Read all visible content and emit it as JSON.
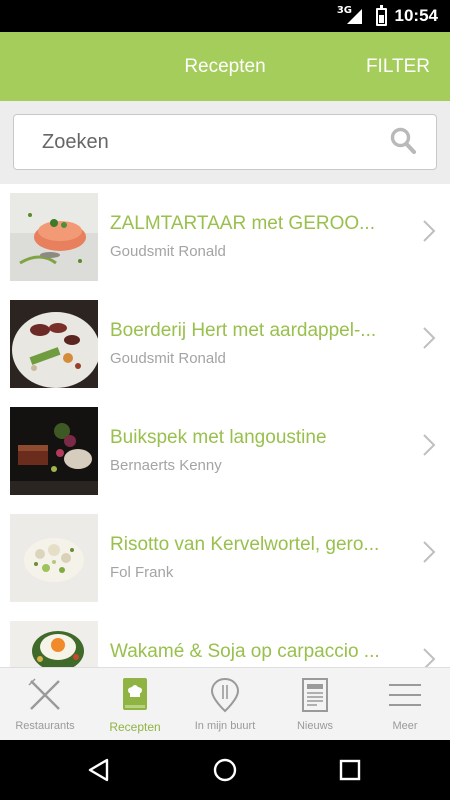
{
  "status_bar": {
    "network": "3G",
    "time": "10:54"
  },
  "header": {
    "title": "Recepten",
    "filter_label": "FILTER"
  },
  "search": {
    "placeholder": "Zoeken",
    "value": ""
  },
  "recipes": [
    {
      "name": "ZALMTARTAAR met GEROO...",
      "author": "Goudsmit Ronald"
    },
    {
      "name": "Boerderij Hert met aardappel-...",
      "author": "Goudsmit Ronald"
    },
    {
      "name": "Buikspek met langoustine",
      "author": "Bernaerts Kenny"
    },
    {
      "name": "Risotto van Kervelwortel, gero...",
      "author": "Fol Frank"
    },
    {
      "name": "Wakamé & Soja op carpaccio ...",
      "author": ""
    }
  ],
  "nav": {
    "items": [
      {
        "label": "Restaurants",
        "icon": "cutlery-icon",
        "active": false
      },
      {
        "label": "Recepten",
        "icon": "chef-hat-book-icon",
        "active": true
      },
      {
        "label": "In mijn buurt",
        "icon": "map-pin-icon",
        "active": false
      },
      {
        "label": "Nieuws",
        "icon": "newspaper-icon",
        "active": false
      },
      {
        "label": "Meer",
        "icon": "menu-icon",
        "active": false
      }
    ]
  },
  "colors": {
    "accent": "#a5cd5b",
    "title_text": "#99c04d",
    "author_text": "#a4a4a4"
  }
}
